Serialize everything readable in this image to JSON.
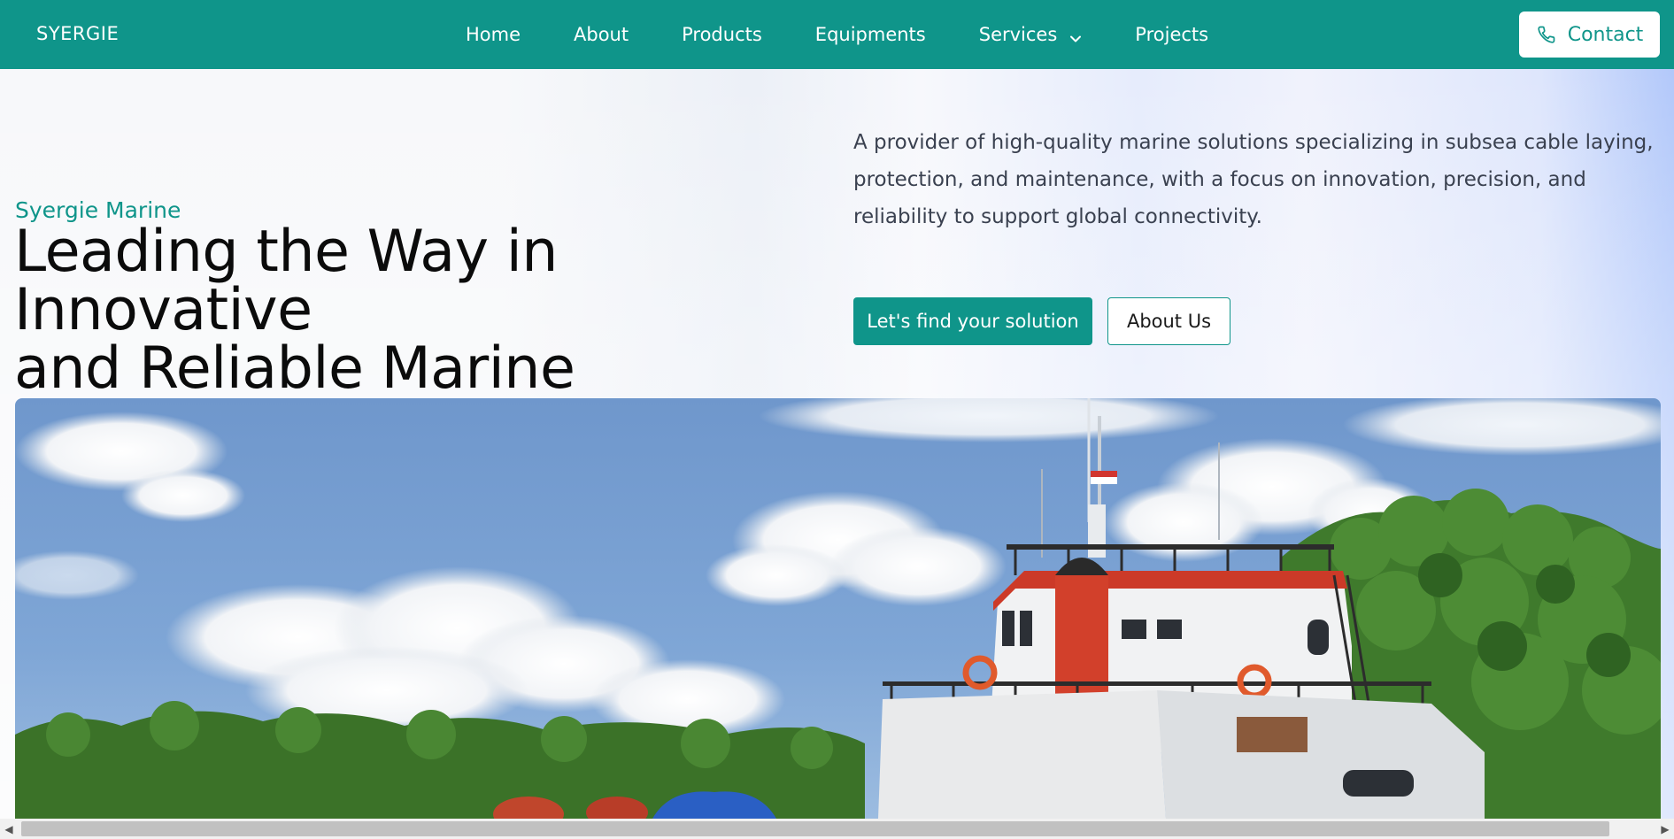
{
  "navbar": {
    "brand": "SYERGIE",
    "links": [
      {
        "label": "Home"
      },
      {
        "label": "About"
      },
      {
        "label": "Products"
      },
      {
        "label": "Equipments"
      },
      {
        "label": "Services",
        "has_dropdown": true
      },
      {
        "label": "Projects"
      }
    ],
    "contact_label": "Contact"
  },
  "hero": {
    "eyebrow": "Syergie Marine",
    "headline_line1": "Leading the Way in Innovative",
    "headline_line2": "and Reliable Marine Solutions",
    "description": "A provider of high-quality marine solutions specializing in subsea cable laying, protection, and maintenance, with a focus on innovation, precision, and reliability to support global connectivity.",
    "primary_cta": "Let's find your solution",
    "secondary_cta": "About Us"
  },
  "icons": {
    "services_dropdown": "chevron-down-icon",
    "contact": "phone-icon",
    "scroll_left": "scroll-left-arrow-icon",
    "scroll_right": "scroll-right-arrow-icon"
  },
  "colors": {
    "brand_teal": "#0f958a",
    "text_dark": "#0b0b0b",
    "text_muted": "#3a4150"
  },
  "scrollbar": {
    "left_arrow": "◀",
    "right_arrow": "▶"
  }
}
